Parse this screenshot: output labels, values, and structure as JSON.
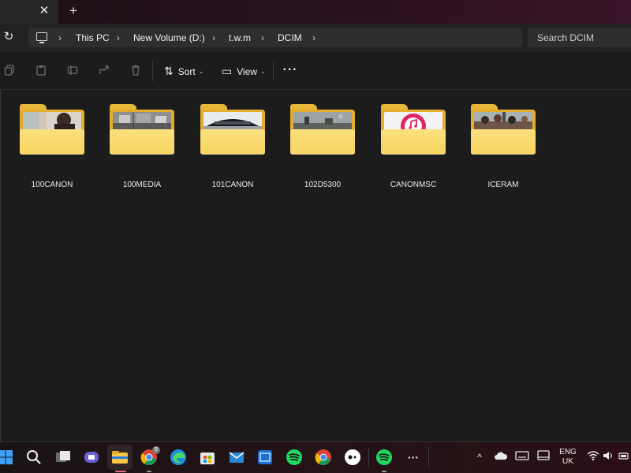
{
  "tabs": {
    "close_glyph": "✕",
    "new_tab_glyph": "+"
  },
  "address": {
    "refresh_glyph": "↻",
    "crumbs": [
      "This PC",
      "New Volume (D:)",
      "t.w.m",
      "DCIM"
    ],
    "separator": "›",
    "search_placeholder": "Search DCIM"
  },
  "toolbar": {
    "sort_label": "Sort",
    "view_label": "View",
    "more_glyph": "···",
    "caret_glyph": "⌄",
    "icons": [
      "copy-icon",
      "paste-icon",
      "rename-icon",
      "share-icon",
      "delete-icon"
    ]
  },
  "folders": [
    {
      "name": "100CANON",
      "thumb": "person-photo"
    },
    {
      "name": "100MEDIA",
      "thumb": "street-photo"
    },
    {
      "name": "101CANON",
      "thumb": "car-photo"
    },
    {
      "name": "102D5300",
      "thumb": "landscape-photo"
    },
    {
      "name": "CANONMSC",
      "thumb": "music-icon"
    },
    {
      "name": "ICERAM",
      "thumb": "crowd-photo"
    }
  ],
  "colors": {
    "background": "#1c1c1c",
    "folder_front": "#f7d45f",
    "folder_back": "#e4ad2e",
    "accent_red": "#e0245e"
  },
  "taskbar": {
    "apps": [
      "start-icon",
      "search-icon",
      "task-view-icon",
      "teams-icon",
      "file-explorer-icon",
      "chrome-icon",
      "edge-icon",
      "store-icon",
      "mail-icon",
      "app-icon",
      "spotify-icon",
      "chrome-icon",
      "app-icon",
      "spotify-icon",
      "more-icon"
    ],
    "chrome_badge": "9",
    "more_glyph": "···",
    "tray_chevron": "^",
    "language_line1": "ENG",
    "language_line2": "UK"
  }
}
